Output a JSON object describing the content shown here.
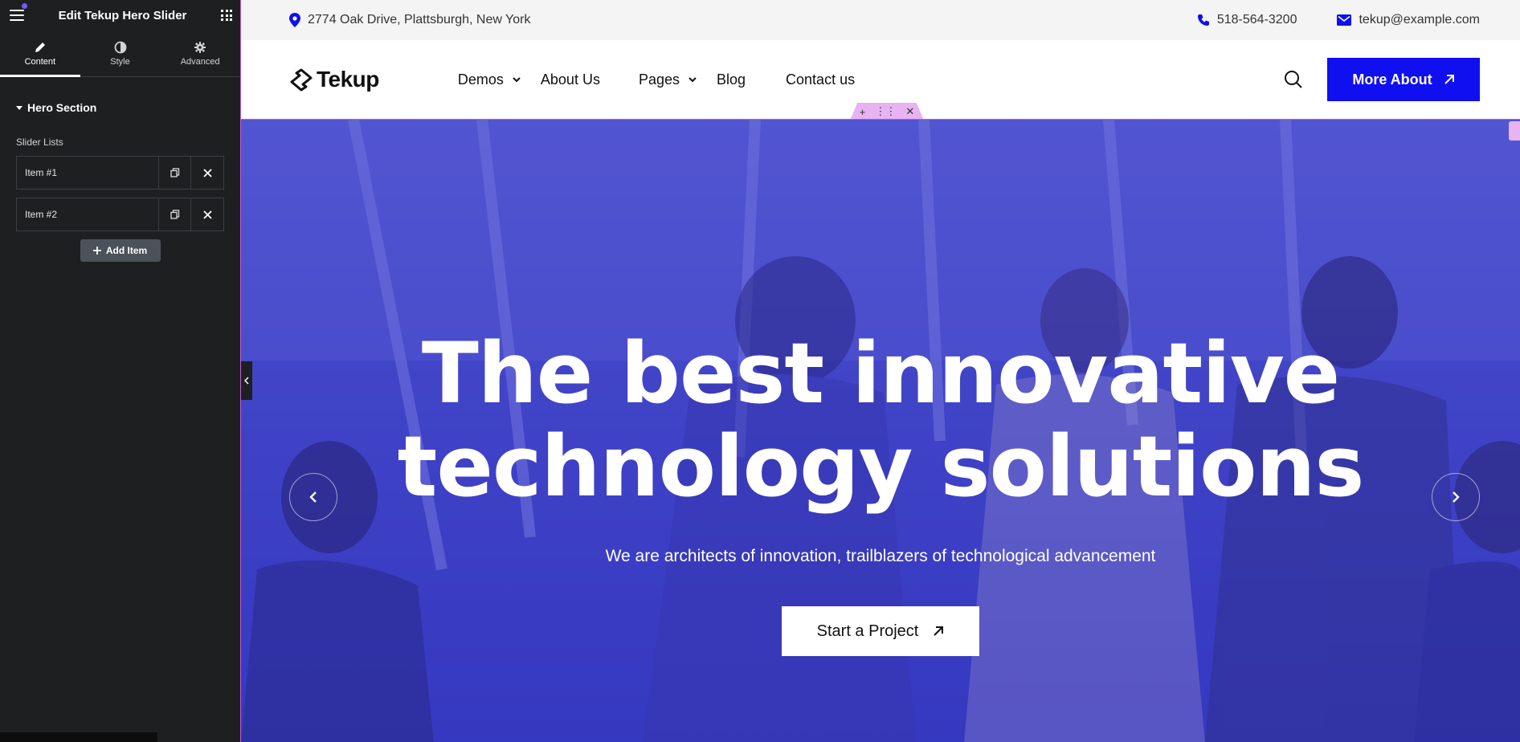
{
  "panel": {
    "title": "Edit Tekup Hero Slider",
    "tabs": [
      {
        "label": "Content",
        "icon": "pencil-icon",
        "active": true
      },
      {
        "label": "Style",
        "icon": "half-circle-icon",
        "active": false
      },
      {
        "label": "Advanced",
        "icon": "gear-icon",
        "active": false
      }
    ],
    "section_title": "Hero Section",
    "slider_lists_label": "Slider Lists",
    "items": [
      "Item #1",
      "Item #2"
    ],
    "add_item_label": "Add Item"
  },
  "topbar": {
    "address": "2774 Oak Drive, Plattsburgh, New York",
    "phone": "518-564-3200",
    "email": "tekup@example.com"
  },
  "header": {
    "logo_text": "Tekup",
    "nav": [
      {
        "label": "Demos",
        "dropdown": true
      },
      {
        "label": "About Us",
        "dropdown": false
      },
      {
        "label": "Pages",
        "dropdown": true
      },
      {
        "label": "Blog",
        "dropdown": false
      },
      {
        "label": "Contact us",
        "dropdown": false
      }
    ],
    "cta_label": "More About"
  },
  "hero": {
    "title_line1": "The best innovative",
    "title_line2": "technology solutions",
    "subtitle": "We are architects of innovation, trailblazers of technological advancement",
    "button_label": "Start a Project"
  },
  "colors": {
    "panel_bg": "#1e1f21",
    "brand_blue": "#0f0ff0",
    "hero_overlay": "#4a4fc6",
    "editor_accent": "#e7b3f0"
  }
}
